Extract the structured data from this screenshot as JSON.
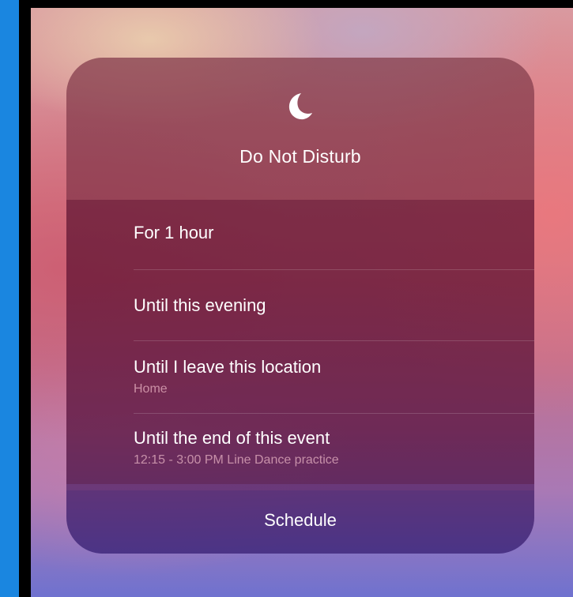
{
  "panel": {
    "title": "Do Not Disturb",
    "icon": "moon-icon",
    "options": [
      {
        "label": "For 1 hour",
        "sub": ""
      },
      {
        "label": "Until this evening",
        "sub": ""
      },
      {
        "label": "Until I leave this location",
        "sub": "Home"
      },
      {
        "label": "Until the end of this event",
        "sub": "12:15 - 3:00 PM Line Dance practice"
      }
    ],
    "schedule_label": "Schedule"
  },
  "colors": {
    "outer_background": "#1a86e0",
    "bezel": "#000000",
    "text": "#ffffff"
  }
}
